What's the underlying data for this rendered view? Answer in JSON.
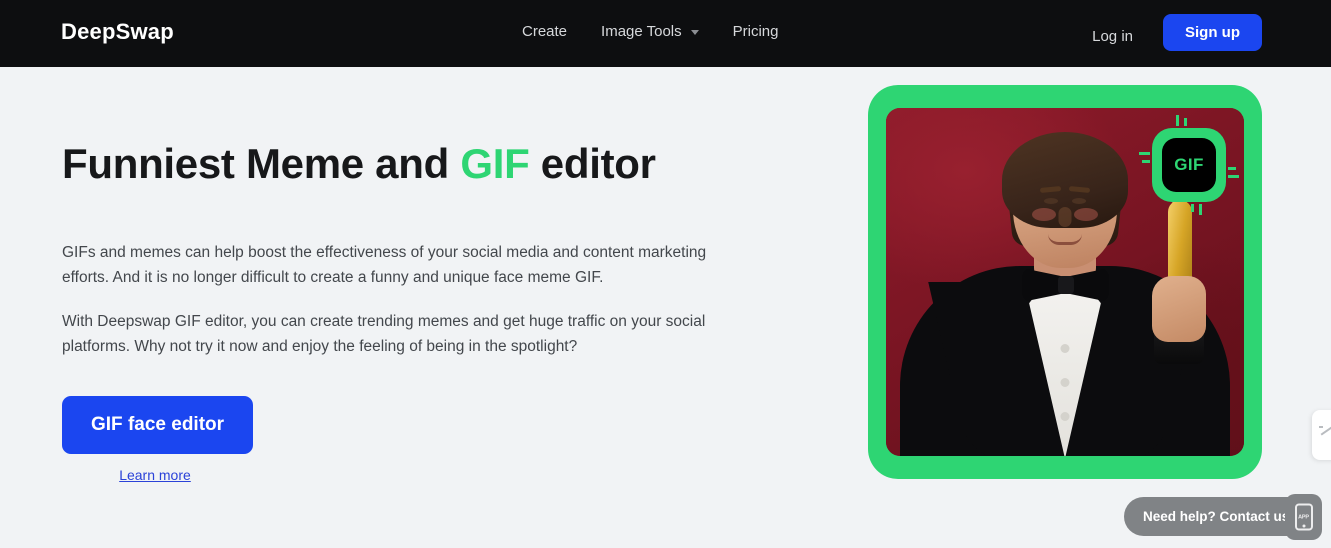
{
  "header": {
    "logo": "DeepSwap",
    "nav": [
      {
        "label": "Create",
        "has_caret": false
      },
      {
        "label": "Image Tools",
        "has_caret": true
      },
      {
        "label": "Pricing",
        "has_caret": false
      }
    ],
    "login_label": "Log in",
    "signup_label": "Sign up",
    "background_color": "#0d0e10",
    "accent_color": "#1b46f0"
  },
  "hero": {
    "headline_before": "Funniest Meme and ",
    "headline_accent": "GIF",
    "headline_after": " editor",
    "accent_green": "#2ed573",
    "paragraph1": "GIFs and memes can help boost the effectiveness of your social media and content marketing efforts. And it is no longer difficult to create a funny and unique face meme GIF.",
    "paragraph2": "With Deepswap GIF editor, you can create trending memes and get huge traffic on your social platforms. Why not try it now and enjoy the feeling of being in the spotlight?",
    "cta_label": "GIF face editor",
    "learn_more_label": "Learn more"
  },
  "media": {
    "badge_label": "GIF",
    "frame_color": "#2ed573",
    "photo_alt": "Man in black tuxedo with bow tie holding a golden Oscar statuette against a dark red backdrop"
  },
  "widgets": {
    "contact_label": "Need help? Contact us!",
    "app_icon_label": "APP",
    "widget_color": "#808386"
  },
  "page": {
    "background_color": "#f1f3f5"
  }
}
